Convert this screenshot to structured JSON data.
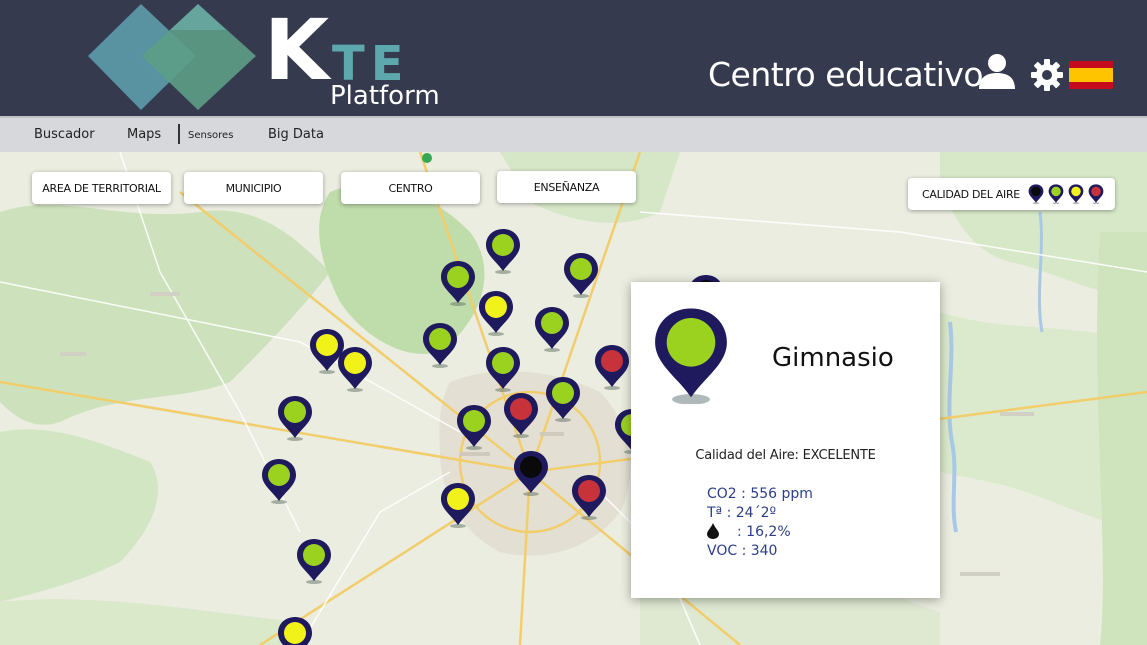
{
  "header": {
    "logo": {
      "letter_k": "K",
      "letters_te": "TE",
      "subtitle": "Platform"
    },
    "title": "Centro educativo",
    "icons": [
      "user-icon",
      "gear-icon",
      "spain-flag-icon"
    ],
    "colors": {
      "background": "#353a4e",
      "logo_teal": "#5ca8ac"
    }
  },
  "nav": {
    "items": [
      {
        "label": "Buscador"
      },
      {
        "label": "Maps"
      },
      {
        "label": "Sensores"
      },
      {
        "label": "Big Data"
      }
    ]
  },
  "filters": [
    {
      "label": "AREA DE TERRITORIAL"
    },
    {
      "label": "MUNICIPIO"
    },
    {
      "label": "CENTRO"
    },
    {
      "label": "ENSEÑANZA"
    }
  ],
  "legend": {
    "label": "CALIDAD DEL AIRE",
    "levels": [
      {
        "name": "black",
        "color": "#0a0a0a"
      },
      {
        "name": "green",
        "color": "#9ad21f"
      },
      {
        "name": "yellow",
        "color": "#f2f21b"
      },
      {
        "name": "red",
        "color": "#c8323a"
      }
    ]
  },
  "pin_colors": {
    "outline": "#1f1a5e",
    "green": "#9ad21f",
    "yellow": "#f2f21b",
    "red": "#c8323a",
    "black": "#0a0a0a"
  },
  "popup": {
    "title": "Gimnasio",
    "quality": "Calidad del Aire: EXCELENTE",
    "co2": "CO2 : 556 ppm",
    "temp": "Tª    : 24´2º",
    "humidity": ":  16,2%",
    "voc": "VOC : 340"
  }
}
